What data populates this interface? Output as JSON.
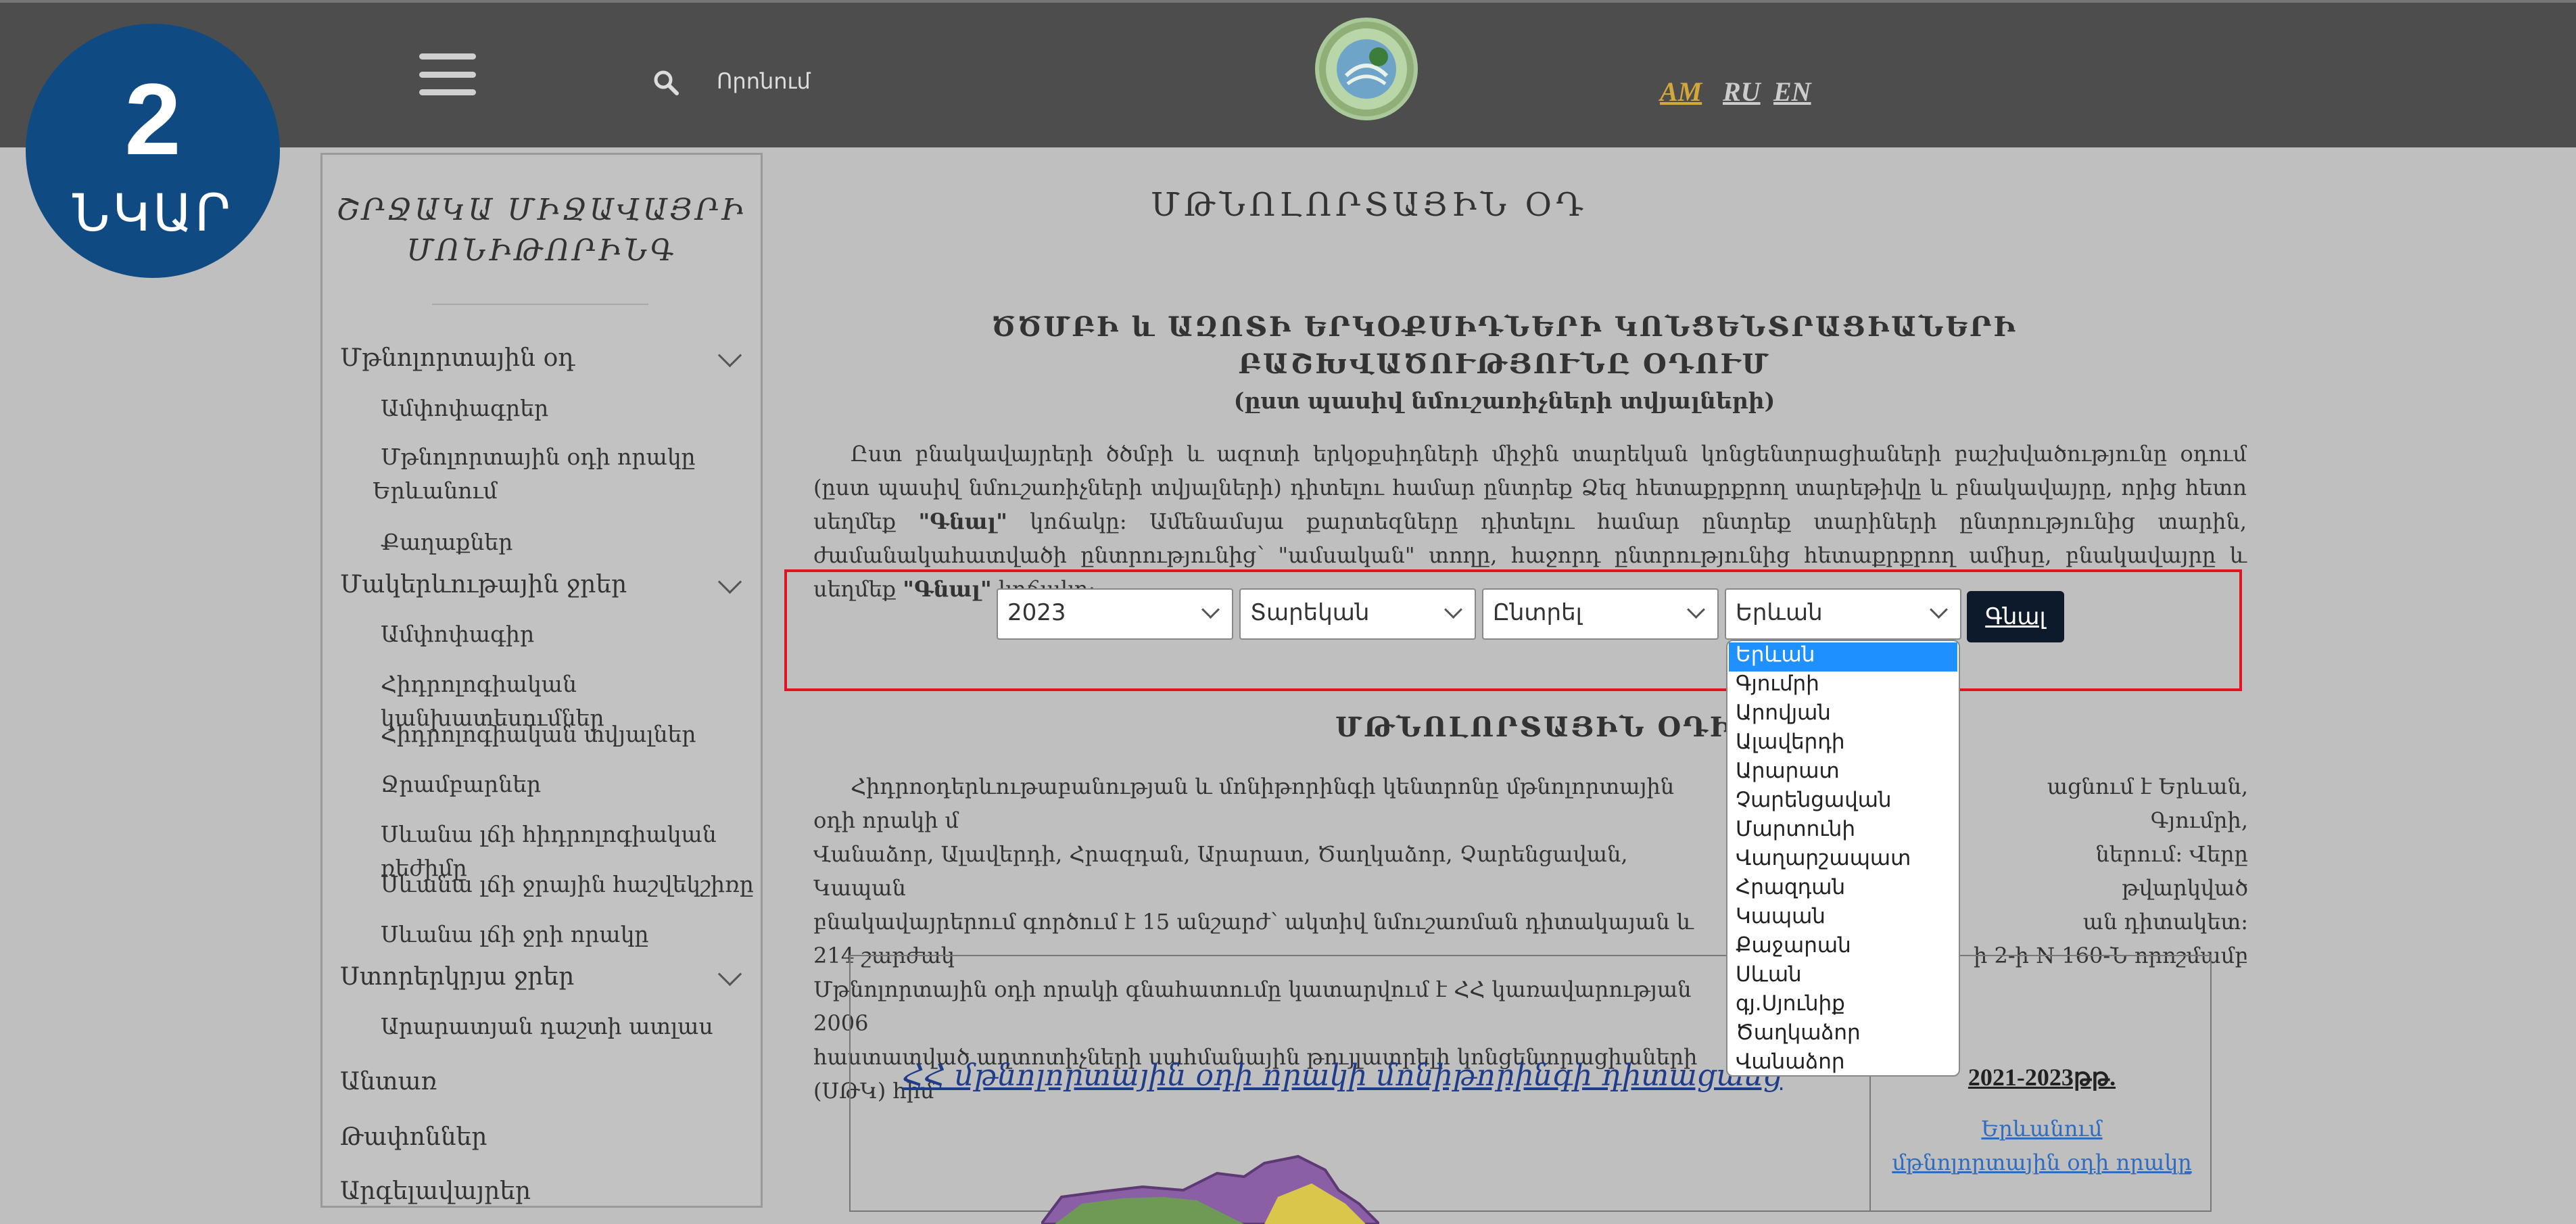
{
  "header": {
    "search_label": "Որոնում",
    "languages": [
      "AM",
      "RU",
      "EN"
    ],
    "active_language": "AM"
  },
  "badge": {
    "number": "2",
    "text": "ՆԿԱՐ"
  },
  "sidebar": {
    "title_line1": "ՇՐՋԱԿԱ ՄԻՋԱՎԱՅՐԻ",
    "title_line2": "ՄՈՆԻԹՈՐԻՆԳ",
    "sections": [
      {
        "label": "Մթնոլորտային օդ",
        "items": [
          "Ամփոփագրեր",
          "Մթնոլորտային օդի որակը",
          "Երևանում",
          "Քաղաքներ"
        ]
      },
      {
        "label": "Մակերևութային ջրեր",
        "items": [
          "Ամփոփագիր",
          "Հիդրոլոգիական կանխատեսումներ",
          "Հիդրոլոգիական տվյալներ",
          "Ջրամբարներ",
          "Սևանա լճի հիդրոլոգիական ռեժիմը",
          "Սևանա լճի ջրային հաշվեկշիռը",
          "Սևանա լճի ջրի որակը"
        ]
      },
      {
        "label": "Ստորերկրյա ջրեր",
        "items": [
          "Արարատյան դաշտի ատլաս"
        ]
      },
      {
        "label": "Անտառ"
      },
      {
        "label": "Թափոններ"
      },
      {
        "label": "Արգելավայրեր"
      }
    ]
  },
  "main": {
    "page_title": "ՄԹՆՈԼՈՐՏԱՅԻՆ ՕԴ",
    "section1_line1": "ԾԾՄԲԻ և ԱԶՈՏԻ ԵՐԿՕՔՍԻԴՆԵՐԻ ԿՈՆՑԵՆՏՐԱՑԻԱՆԵՐԻ",
    "section1_line2": "ԲԱՇԽՎԱԾՈՒԹՅՈՒՆԸ ՕԴՈՒՄ",
    "section1_line3": "(ըստ պասիվ նմուշառիչների տվյալների)",
    "para1_a": "Ըստ բնակավայրերի ծծմբի և ազոտի երկօքսիդների միջին տարեկան կոնցենտրացիաների բաշխվածությունը օդում (ըստ պասիվ նմուշառիչների տվյալների) դիտելու համար ընտրեք Ձեզ հետաքրքրող տարեթիվը և բնակավայրը, որից հետո սեղմեք ",
    "para1_go1": "\"Գնալ\"",
    "para1_b": " կոճակը: Ամենամսյա քարտեզները դիտելու համար ընտրեք տարիների ընտրությունից տարին, ժամանակահատվածի ընտրությունից՝ \"ամսական\" տողը, հաջորդ ընտրությունից հետաքրքրող ամիսը, բնակավայրը և սեղմեք ",
    "para1_go2": "\"Գնալ\"",
    "para1_c": " կոճակը:",
    "section2_title": "ՄԹՆՈԼՈՐՏԱՅԻՆ ՕԴԻ ՈՐԱԿ",
    "para2_l1a": "Հիդրոօդերևութաբանության և մոնիթորինգի կենտրոնը մթնոլորտային օդի որակի մ",
    "para2_l1b": "ացնում է Երևան, Գյումրի,",
    "para2_l2a": "Վանաձոր, Ալավերդի, Հրազդան, Արարատ, Ծաղկաձոր, Չարենցավան, Կապան",
    "para2_l2b": "ներում: Վերը թվարկված",
    "para2_l3a": "բնակավայրերում գործում է 15 անշարժ՝ ակտիվ նմուշառման դիտակայան և 214 շարժակ",
    "para2_l3b": "ան դիտակետ:",
    "para2_l4a": "Մթնոլորտային օդի որակի գնահատումը կատարվում է ՀՀ կառավարության 2006",
    "para2_l4b": "ի 2-ի N 160-Ն որոշմամբ",
    "para2_l5a": "հաստատված աղտոտիչների սահմանային թույլատրելի կոնցենտրացիաների (ՍԹԿ) հիմ"
  },
  "filters": {
    "year": "2023",
    "period": "Տարեկան",
    "choose": "Ընտրել",
    "city": "Երևան",
    "go_label": "Գնալ"
  },
  "dropdown": {
    "options": [
      "Երևան",
      "Գյումրի",
      "Արովյան",
      "Ալավերդի",
      "Արարատ",
      "Չարենցավան",
      "Մարտունի",
      "Վաղարշապատ",
      "Հրազդան",
      "Կապան",
      "Քաջարան",
      "Սևան",
      "գյ.Սյունիք",
      "Ծաղկաձոր",
      "Վանաձոր"
    ],
    "selected_index": 0
  },
  "map_panel": {
    "link_text": "ՀՀ մթնոլորտային օդի որակի մոնիթորինգի դիտացանց",
    "years": "2021-2023թթ.",
    "side_link1": "Երևանում",
    "side_link2": "մթնոլորտային օդի որակը"
  },
  "colors": {
    "header_bg": "#4d4d4d",
    "badge_bg": "#0f4b82",
    "accent_lang": "#d4a63b",
    "filter_border": "#e0141e",
    "dropdown_selected": "#1e90ff"
  }
}
